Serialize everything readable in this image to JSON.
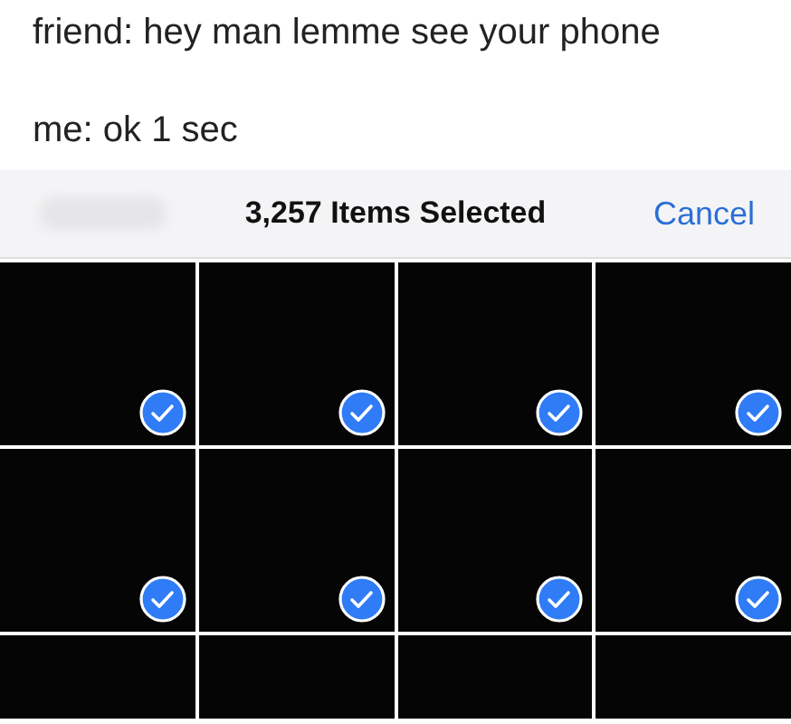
{
  "caption": [
    "friend: hey man lemme see your phone",
    "me: ok 1 sec"
  ],
  "nav_bar": {
    "title": "3,257 Items Selected",
    "cancel": "Cancel"
  },
  "photos": [
    {
      "kind": "full",
      "selected": true
    },
    {
      "kind": "full",
      "selected": true
    },
    {
      "kind": "full",
      "selected": true
    },
    {
      "kind": "full",
      "selected": true
    },
    {
      "kind": "full",
      "selected": true
    },
    {
      "kind": "full",
      "selected": true
    },
    {
      "kind": "full",
      "selected": true
    },
    {
      "kind": "full",
      "selected": true
    },
    {
      "kind": "partial"
    },
    {
      "kind": "partial"
    },
    {
      "kind": "partial"
    },
    {
      "kind": "partial"
    }
  ]
}
